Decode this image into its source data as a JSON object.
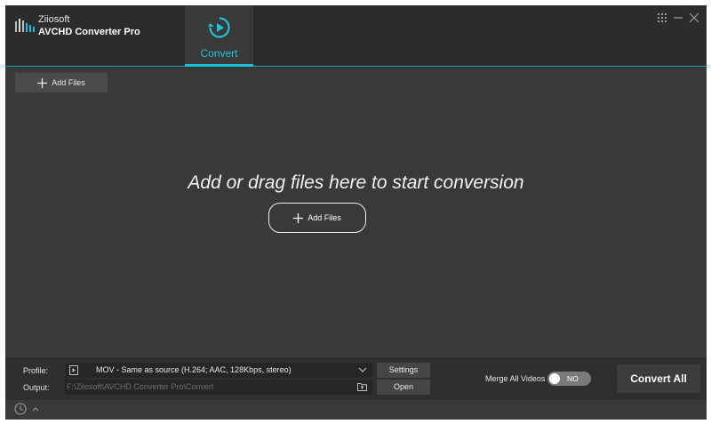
{
  "app": {
    "brand_line1": "Ziiosoft",
    "brand_line2": "AVCHD Converter Pro"
  },
  "tabs": [
    {
      "label": "Convert",
      "icon": "convert-play-icon",
      "active": true
    }
  ],
  "window_controls": [
    "grid-icon",
    "minimize-icon",
    "close-icon"
  ],
  "toolbar": {
    "add_files_label": "Add Files"
  },
  "drop_area": {
    "title": "Add or drag files here to start conversion",
    "add_files_label": "Add Files"
  },
  "bottom": {
    "profile_label": "Profile:",
    "profile_value": "MOV - Same as source (H.264; AAC, 128Kbps, stereo)",
    "output_label": "Output:",
    "output_path": "F:\\Ziiosoft\\AVCHD Converter Pro\\Convert",
    "settings_label": "Settings",
    "open_label": "Open",
    "merge_label": "Merge All Videos",
    "merge_toggle_state": "NO",
    "convert_all_label": "Convert All"
  },
  "colors": {
    "accent": "#17c2d2",
    "background": "#3a3939",
    "topbar": "#2c2c2c"
  }
}
